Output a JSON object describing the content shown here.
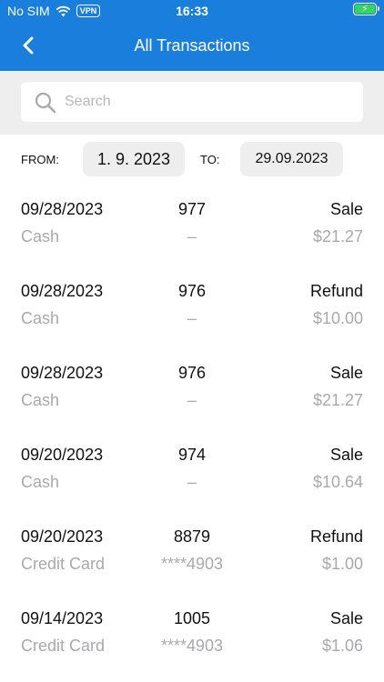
{
  "status": {
    "carrier": "No SIM",
    "vpn": "VPN",
    "time": "16:33"
  },
  "nav": {
    "title": "All Transactions"
  },
  "search": {
    "placeholder": "Search"
  },
  "filters": {
    "from_label": "FROM:",
    "from_value": "1. 9. 2023",
    "to_label": "TO:",
    "to_value": "29.09.2023"
  },
  "transactions": [
    {
      "date": "09/28/2023",
      "number": "977",
      "type": "Sale",
      "method": "Cash",
      "card": "–",
      "amount": "$21.27"
    },
    {
      "date": "09/28/2023",
      "number": "976",
      "type": "Refund",
      "method": "Cash",
      "card": "–",
      "amount": "$10.00"
    },
    {
      "date": "09/28/2023",
      "number": "976",
      "type": "Sale",
      "method": "Cash",
      "card": "–",
      "amount": "$21.27"
    },
    {
      "date": "09/20/2023",
      "number": "974",
      "type": "Sale",
      "method": "Cash",
      "card": "–",
      "amount": "$10.64"
    },
    {
      "date": "09/20/2023",
      "number": "8879",
      "type": "Refund",
      "method": "Credit Card",
      "card": "****4903",
      "amount": "$1.00"
    },
    {
      "date": "09/14/2023",
      "number": "1005",
      "type": "Sale",
      "method": "Credit Card",
      "card": "****4903",
      "amount": "$1.06"
    }
  ]
}
